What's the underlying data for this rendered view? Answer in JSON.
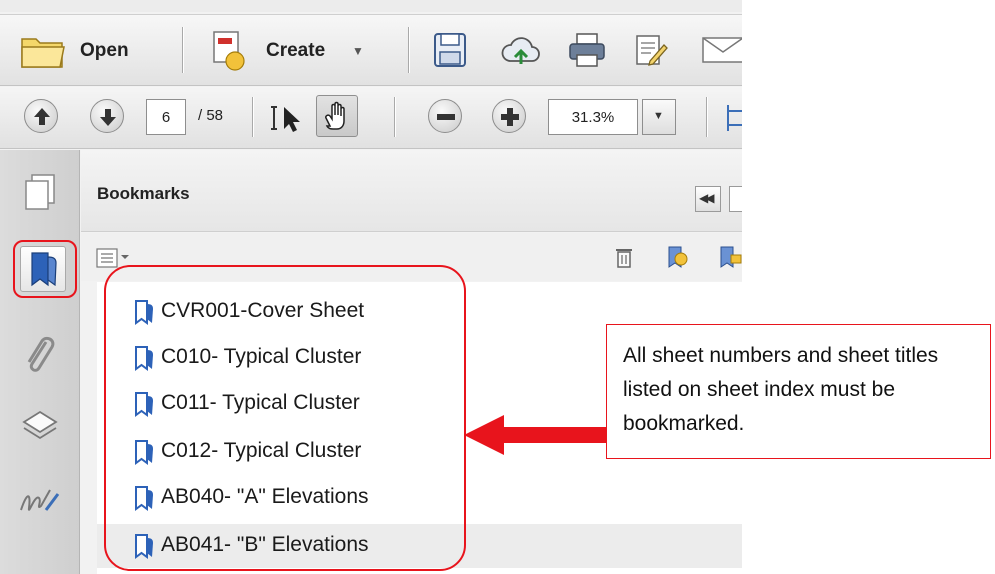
{
  "toolbar": {
    "open_label": "Open",
    "create_label": "Create",
    "page_current": "6",
    "page_total": "/ 58",
    "zoom_value": "31.3%"
  },
  "panel": {
    "title": "Bookmarks"
  },
  "bookmarks": [
    {
      "label": "CVR001-Cover Sheet"
    },
    {
      "label": "C010- Typical Cluster"
    },
    {
      "label": "C011- Typical Cluster"
    },
    {
      "label": "C012- Typical Cluster"
    },
    {
      "label": "AB040- \"A\" Elevations"
    },
    {
      "label": "AB041- \"B\" Elevations"
    }
  ],
  "annotation": {
    "callout_text": "All sheet numbers and sheet titles listed on sheet index must be bookmarked."
  },
  "colors": {
    "annotation_red": "#e8141c",
    "bookmark_icon_blue": "#2d62b8"
  },
  "icons": [
    "folder-icon",
    "create-pdf-icon",
    "save-icon",
    "cloud-upload-icon",
    "print-icon",
    "edit-icon",
    "email-icon",
    "page-up-icon",
    "page-down-icon",
    "select-cursor-icon",
    "hand-tool-icon",
    "zoom-out-icon",
    "zoom-in-icon",
    "page-thumbnails-icon",
    "bookmark-icon",
    "attachment-paperclip-icon",
    "layers-icon",
    "signature-icon",
    "bookmark-options-icon",
    "delete-bookmark-icon",
    "new-bookmark-icon",
    "collapse-panel-icon"
  ]
}
